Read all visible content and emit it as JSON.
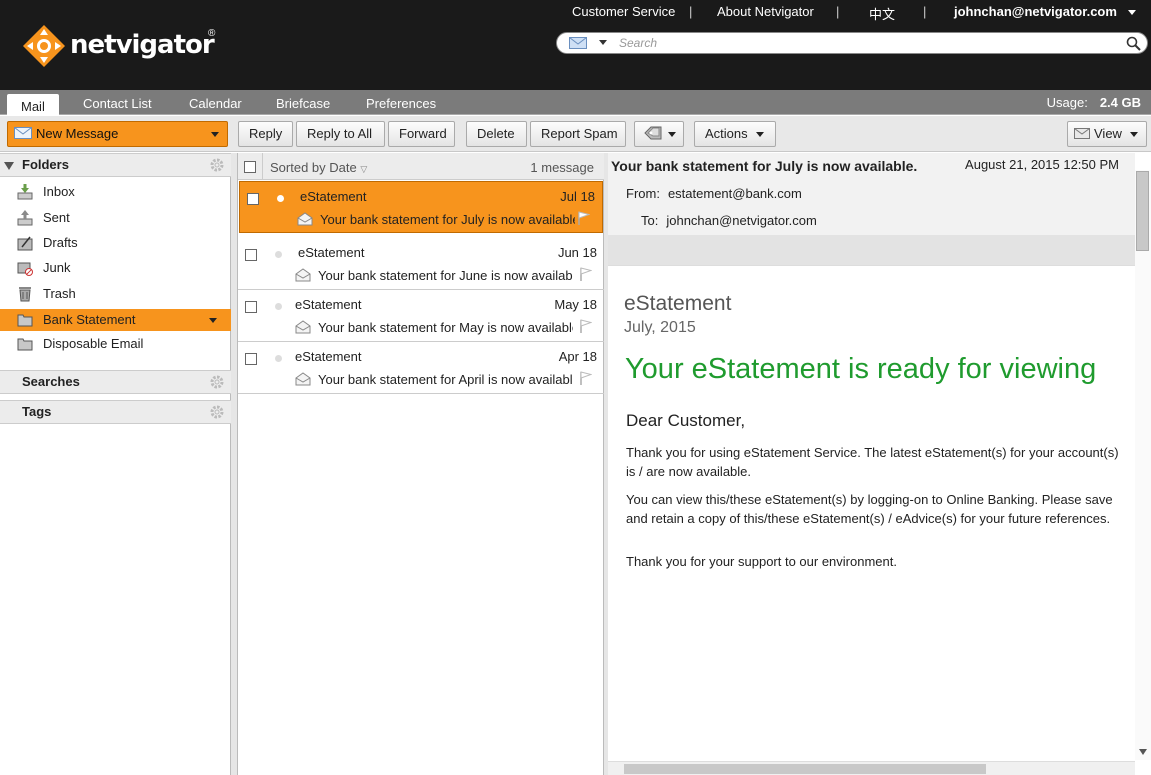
{
  "header": {
    "logo_text": "netvigator",
    "logo_mark": "®",
    "links": [
      "Customer Service",
      "About Netvigator",
      "中文"
    ],
    "separator": "|",
    "user": "johnchan@netvigator.com",
    "search_placeholder": "Search"
  },
  "tabs": [
    "Mail",
    "Contact List",
    "Calendar",
    "Briefcase",
    "Preferences"
  ],
  "usage": {
    "label": "Usage:",
    "value": "2.4 GB"
  },
  "toolbar": {
    "new_message": "New Message",
    "reply": "Reply",
    "reply_all": "Reply to All",
    "forward": "Forward",
    "delete": "Delete",
    "report_spam": "Report Spam",
    "actions": "Actions",
    "view": "View"
  },
  "sidebar": {
    "folders_title": "Folders",
    "folders": [
      "Inbox",
      "Sent",
      "Drafts",
      "Junk",
      "Trash",
      "Bank Statement",
      "Disposable Email"
    ],
    "searches_title": "Searches",
    "tags_title": "Tags"
  },
  "message_list": {
    "sort_label": "Sorted by Date",
    "count_label": "1 message",
    "messages": [
      {
        "sender": "eStatement",
        "date": "Jul 18",
        "subject": "Your bank statement for July is now available"
      },
      {
        "sender": "eStatement",
        "date": "Jun 18",
        "subject": "Your bank statement for June is now available"
      },
      {
        "sender": "eStatement",
        "date": "May 18",
        "subject": "Your bank statement for May is now available"
      },
      {
        "sender": "eStatement",
        "date": "Apr 18",
        "subject": "Your bank statement for April is now available"
      }
    ]
  },
  "reading": {
    "subject": "Your bank statement for July is now available.",
    "date": "August 21, 2015 12:50 PM",
    "from_label": "From:",
    "from": "estatement@bank.com",
    "to_label": "To:",
    "to": "johnchan@netvigator.com",
    "body": {
      "brand": "eStatement",
      "month": "July, 2015",
      "headline": "Your eStatement is ready for viewing",
      "greeting": "Dear Customer,",
      "p1": "Thank you for using eStatement Service. The latest eStatement(s) for your account(s) is / are now available.",
      "p2": "You can view this/these eStatement(s) by logging-on to Online Banking. Please save and retain a copy of this/these eStatement(s) / eAdvice(s) for your future references.",
      "p3": "Thank you for your support to our environment."
    }
  },
  "colors": {
    "accent": "#f7941d",
    "headline_green": "#1f9b2e",
    "header_bg": "#1a1a1a"
  }
}
